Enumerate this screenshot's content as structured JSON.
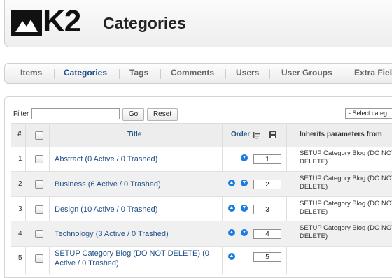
{
  "header": {
    "logo_text": "K2",
    "page_title": "Categories"
  },
  "subnav": {
    "tabs": [
      {
        "label": "Items"
      },
      {
        "label": "Categories",
        "active": true
      },
      {
        "label": "Tags"
      },
      {
        "label": "Comments"
      },
      {
        "label": "Users"
      },
      {
        "label": "User Groups"
      },
      {
        "label": "Extra Fiel"
      }
    ]
  },
  "filter": {
    "label": "Filter",
    "input_value": "",
    "go_label": "Go",
    "reset_label": "Reset",
    "select_value": "- Select categ"
  },
  "table": {
    "headers": {
      "num": "#",
      "title": "Title",
      "order": "Order",
      "inherits": "Inherits parameters from"
    },
    "rows": [
      {
        "num": "1",
        "title": "Abstract (0 Active / 0 Trashed)",
        "order": "1",
        "inherits": "SETUP Category Blog (DO NOT DELETE)",
        "up": false,
        "down": true
      },
      {
        "num": "2",
        "title": "Business (6 Active / 0 Trashed)",
        "order": "2",
        "inherits": "SETUP Category Blog (DO NOT DELETE)",
        "up": true,
        "down": true
      },
      {
        "num": "3",
        "title": "Design (10 Active / 0 Trashed)",
        "order": "3",
        "inherits": "SETUP Category Blog (DO NOT DELETE)",
        "up": true,
        "down": true
      },
      {
        "num": "4",
        "title": "Technology (3 Active / 0 Trashed)",
        "order": "4",
        "inherits": "SETUP Category Blog (DO NOT DELETE)",
        "up": true,
        "down": true
      },
      {
        "num": "5",
        "title": "SETUP Category Blog (DO NOT DELETE) (0 Active / 0 Trashed)",
        "order": "5",
        "inherits": "",
        "up": true,
        "down": false
      }
    ]
  }
}
